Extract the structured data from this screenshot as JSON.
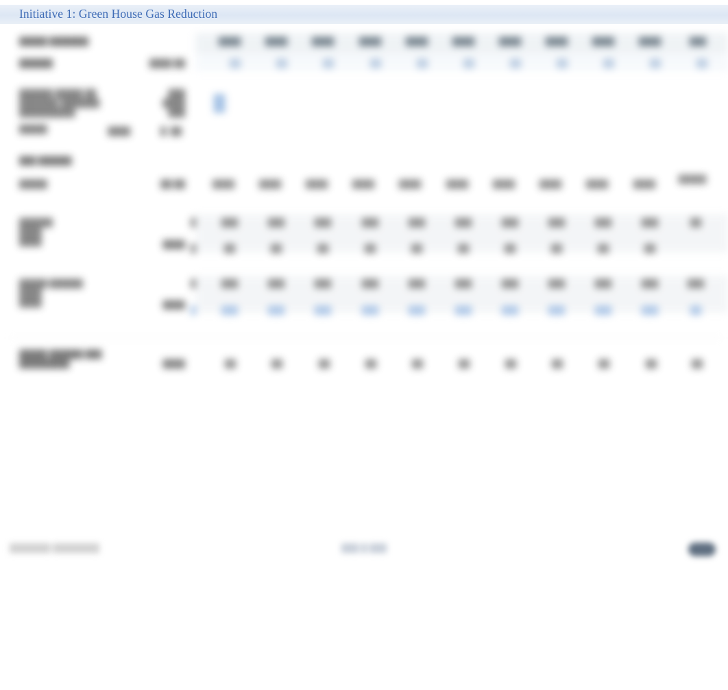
{
  "document": {
    "title": "Initiative 1: Green House Gas Reduction",
    "accent_color": "#3f6cb6",
    "title_band_color": "#dde7f4",
    "page_background": "#ffffff"
  },
  "table": {
    "header_row_1": {
      "label": "",
      "unit_label": "",
      "columns": [
        "",
        "",
        "",
        "",
        "",
        "",
        "",
        "",
        "",
        "",
        ""
      ]
    },
    "header_row_2": {
      "label": "",
      "unit_label": "",
      "columns": [
        "",
        "",
        "",
        "",
        "",
        "",
        "",
        "",
        "",
        "",
        ""
      ]
    },
    "rows": [
      {
        "name": "row-objective",
        "label": "",
        "label_line2": "",
        "label_line3": "",
        "value": "",
        "badge": "",
        "columns": []
      },
      {
        "name": "row-target",
        "label": "",
        "value": "",
        "columns": []
      },
      {
        "name": "row-section-heading",
        "label": "",
        "value": "",
        "columns": []
      },
      {
        "name": "row-metric-1",
        "label": "",
        "label_line2": "",
        "value": "",
        "columns": [
          "",
          "",
          "",
          "",
          "",
          "",
          "",
          "",
          "",
          "",
          ""
        ]
      },
      {
        "name": "row-metric-2",
        "label": "",
        "label_line2": "",
        "label_line3": "",
        "value": "",
        "columns_top": [
          "",
          "",
          "",
          "",
          "",
          "",
          "",
          "",
          "",
          "",
          ""
        ],
        "columns_bottom": [
          "",
          "",
          "",
          "",
          "",
          "",
          "",
          "",
          "",
          "",
          ""
        ]
      },
      {
        "name": "row-metric-3",
        "label": "",
        "label_line2": "",
        "label_line3": "",
        "value": "",
        "columns_top": [
          "",
          "",
          "",
          "",
          "",
          "",
          "",
          "",
          "",
          "",
          ""
        ],
        "columns_bottom": [
          "",
          "",
          "",
          "",
          "",
          "",
          "",
          "",
          "",
          "",
          ""
        ]
      },
      {
        "name": "row-summary",
        "label": "",
        "label_line2": "",
        "value": "",
        "columns": [
          "",
          "",
          "",
          "",
          "",
          "",
          "",
          "",
          "",
          "",
          ""
        ]
      }
    ]
  },
  "footer": {
    "left_text": "",
    "center_text": "",
    "logo_name": "logo-mark"
  }
}
